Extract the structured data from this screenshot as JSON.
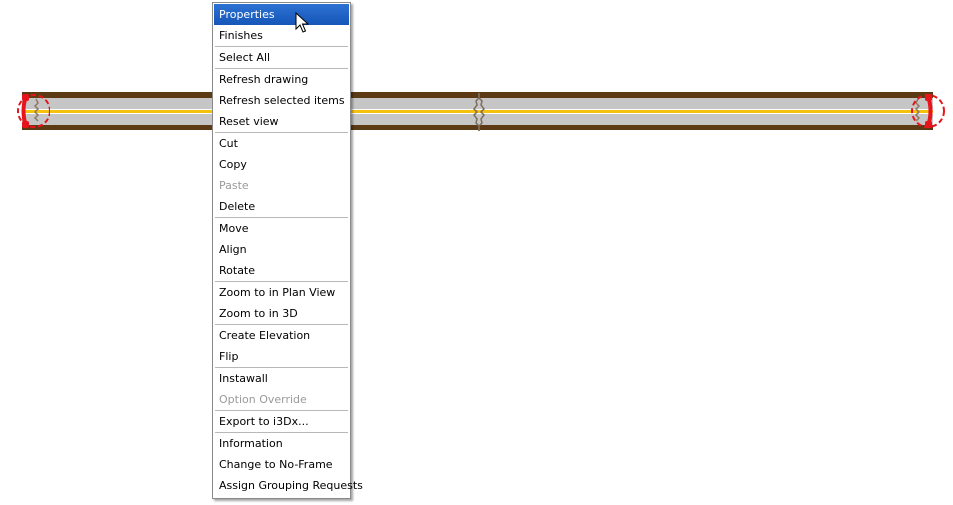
{
  "canvas": {
    "background": "#ffffff",
    "wall": {
      "colors": {
        "frame": "#5c3b14",
        "core": "#c6c6c6",
        "centerline": "#f4c20d"
      }
    },
    "handles": [
      {
        "name": "wall-end-handle-left",
        "color": "#e8141c"
      },
      {
        "name": "wall-midpoint-handle"
      },
      {
        "name": "wall-end-handle-right",
        "color": "#e8141c"
      }
    ]
  },
  "context_menu": {
    "groups": [
      [
        {
          "label": "Properties",
          "state": "selected"
        },
        {
          "label": "Finishes",
          "state": "normal"
        }
      ],
      [
        {
          "label": "Select All",
          "state": "normal"
        }
      ],
      [
        {
          "label": "Refresh drawing",
          "state": "normal"
        },
        {
          "label": "Refresh selected items",
          "state": "normal"
        },
        {
          "label": "Reset view",
          "state": "normal"
        }
      ],
      [
        {
          "label": "Cut",
          "state": "normal"
        },
        {
          "label": "Copy",
          "state": "normal"
        },
        {
          "label": "Paste",
          "state": "disabled"
        },
        {
          "label": "Delete",
          "state": "normal"
        }
      ],
      [
        {
          "label": "Move",
          "state": "normal"
        },
        {
          "label": "Align",
          "state": "normal"
        },
        {
          "label": "Rotate",
          "state": "normal"
        }
      ],
      [
        {
          "label": "Zoom to in Plan View",
          "state": "normal"
        },
        {
          "label": "Zoom to in 3D",
          "state": "normal"
        }
      ],
      [
        {
          "label": "Create Elevation",
          "state": "normal"
        },
        {
          "label": "Flip",
          "state": "normal"
        }
      ],
      [
        {
          "label": "Instawall",
          "state": "normal"
        },
        {
          "label": "Option Override",
          "state": "disabled"
        }
      ],
      [
        {
          "label": "Export to i3Dx...",
          "state": "normal"
        }
      ],
      [
        {
          "label": "Information",
          "state": "normal"
        },
        {
          "label": "Change to No-Frame",
          "state": "normal"
        },
        {
          "label": "Assign Grouping Requests",
          "state": "normal"
        }
      ]
    ],
    "highlight_color": "#1f62c4"
  },
  "cursor": {
    "icon": "mouse-pointer-icon"
  }
}
